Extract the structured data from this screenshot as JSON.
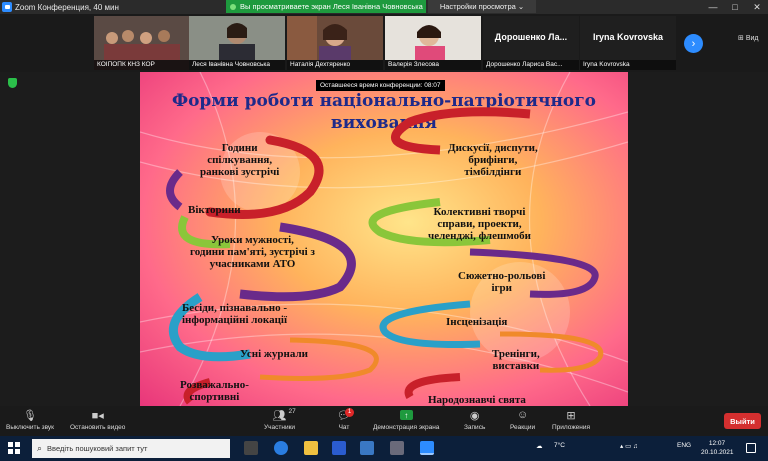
{
  "window": {
    "title": "Zoom Конференция, 40 мин",
    "controls": [
      "—",
      "□",
      "✕"
    ]
  },
  "share_banner": {
    "text": "Вы просматриваете экран Леся Іванівна Човновська"
  },
  "view_options": {
    "label": "Настройки просмотра ⌄"
  },
  "participants": [
    {
      "name": "КОІПОПК КНЗ КОР"
    },
    {
      "name": "Леся Іванівна Човновська"
    },
    {
      "name": "Наталія Дехтяренко"
    },
    {
      "name": "Валерія Злесова"
    },
    {
      "name": "Дорошенко Лариса Вас...",
      "display": "Дорошенко Ла..."
    },
    {
      "name": "Iryna Kovrovska",
      "display": "Iryna Kovrovska"
    }
  ],
  "view_button": {
    "label": "Вид"
  },
  "timer": {
    "text": "Оставшееся время конференции: 08:07"
  },
  "slide": {
    "title_line1": "Форми роботи національно-патріотичного",
    "title_line2": "виховання",
    "left_items": [
      "Години\nспілкування,\nранкові зустрічі",
      "Вікторини",
      "Уроки мужності,\nгодини пам'яті, зустрічі з\nучасниками АТО",
      "Бесіди, пізнавально -\nінформаційні локації",
      "Усні журнали",
      "Розважально-\nспортивні"
    ],
    "right_items": [
      "Дискусії, диспути,\nбрифінги,\nтімбілдінги",
      "Колективні творчі\nсправи, проекти,\nчеленджі, флешмоби",
      "Сюжетно-рольові\nігри",
      "Інсценізація",
      "Тренінги,\nвиставки",
      "Народознавчі свята"
    ]
  },
  "toolbar": {
    "mute": "Выключить звук",
    "video": "Остановить видео",
    "participants": "Участники",
    "participants_count": "27",
    "chat": "Чат",
    "chat_badge": "1",
    "share": "Демонстрация экрана",
    "record": "Запись",
    "reactions": "Реакции",
    "apps": "Приложения",
    "leave": "Выйти"
  },
  "taskbar": {
    "search_placeholder": "Введіть пошуковий запит тут",
    "weather": "7°C",
    "lang": "ENG",
    "time": "12:07",
    "date": "20.10.2021"
  },
  "colors": {
    "accent": "#2d8cff",
    "share_green": "#1e9a3e",
    "leave_red": "#d42f2f",
    "title_blue": "#1e2a8a"
  }
}
